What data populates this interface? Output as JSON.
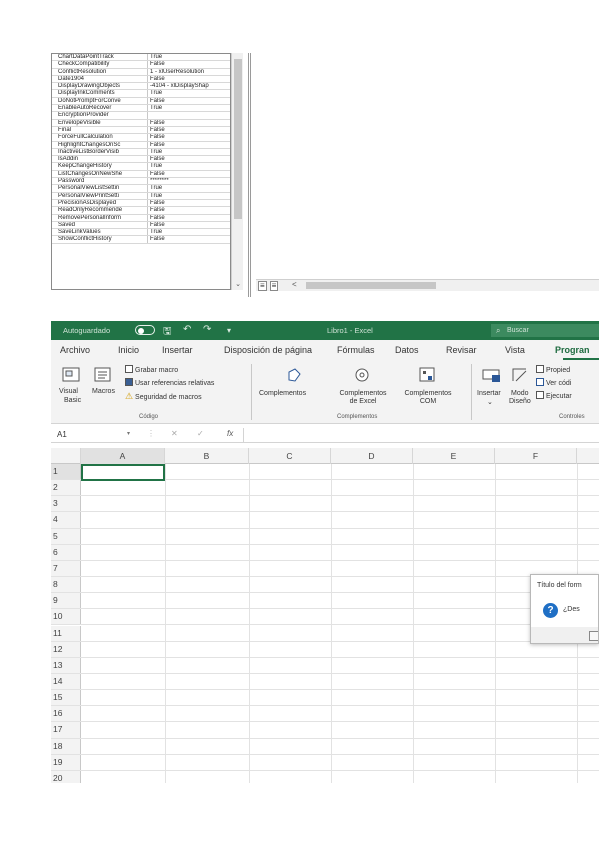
{
  "properties_panel": {
    "rows": [
      {
        "name": "ChartDataPointTrack",
        "value": "True"
      },
      {
        "name": "CheckCompatibility",
        "value": "False"
      },
      {
        "name": "ConflictResolution",
        "value": "1 - xlUserResolution"
      },
      {
        "name": "Date1904",
        "value": "False"
      },
      {
        "name": "DisplayDrawingObjects",
        "value": "-4104 - xlDisplayShap"
      },
      {
        "name": "DisplayInkComments",
        "value": "True"
      },
      {
        "name": "DoNotPromptForConve",
        "value": "False"
      },
      {
        "name": "EnableAutoRecover",
        "value": "True"
      },
      {
        "name": "EncryptionProvider",
        "value": ""
      },
      {
        "name": "EnvelopeVisible",
        "value": "False"
      },
      {
        "name": "Final",
        "value": "False"
      },
      {
        "name": "ForceFullCalculation",
        "value": "False"
      },
      {
        "name": "HighlightChangesOnSc",
        "value": "False"
      },
      {
        "name": "InactiveListBorderVisib",
        "value": "True"
      },
      {
        "name": "IsAddin",
        "value": "False"
      },
      {
        "name": "KeepChangeHistory",
        "value": "True"
      },
      {
        "name": "ListChangesOnNewShe",
        "value": "False"
      },
      {
        "name": "Password",
        "value": "********"
      },
      {
        "name": "PersonalViewListSettin",
        "value": "True"
      },
      {
        "name": "PersonalViewPrintSetti",
        "value": "True"
      },
      {
        "name": "PrecisionAsDisplayed",
        "value": "False"
      },
      {
        "name": "ReadOnlyRecommende",
        "value": "False"
      },
      {
        "name": "RemovePersonalInform",
        "value": "False"
      },
      {
        "name": "Saved",
        "value": "False"
      },
      {
        "name": "SaveLinkValues",
        "value": "True"
      },
      {
        "name": "ShowConflictHistory",
        "value": "False"
      }
    ],
    "scroll_down_arrow": "⌄",
    "hscroll_left_arrow": "<"
  },
  "excel": {
    "titlebar": {
      "autosave_label": "Autoguardado",
      "save_icon": "save-icon",
      "undo_icon": "undo-icon",
      "redo_icon": "redo-icon",
      "title": "Libro1 - Excel",
      "search_placeholder": "Buscar"
    },
    "tabs": [
      {
        "label": "Archivo"
      },
      {
        "label": "Inicio"
      },
      {
        "label": "Insertar"
      },
      {
        "label": "Disposición de página"
      },
      {
        "label": "Fórmulas"
      },
      {
        "label": "Datos"
      },
      {
        "label": "Revisar"
      },
      {
        "label": "Vista"
      },
      {
        "label": "Progran"
      }
    ],
    "ribbon": {
      "visual_basic": "Visual",
      "visual_basic_2": "Basic",
      "macros": "Macros",
      "grabar_macro": "Grabar macro",
      "usar_referencias": "Usar referencias relativas",
      "seguridad_macros": "Seguridad de macros",
      "group_codigo": "Código",
      "complementos": "Complementos",
      "complementos_excel_1": "Complementos",
      "complementos_excel_2": "de Excel",
      "complementos_com_1": "Complementos",
      "complementos_com_2": "COM",
      "group_complementos": "Complementos",
      "insertar": "Insertar",
      "modo_diseno_1": "Modo",
      "modo_diseno_2": "Diseño",
      "propiedades": "Propied",
      "ver_codigo": "Ver códi",
      "ejecutar": "Ejecutar",
      "group_controles": "Controles"
    },
    "formula_bar": {
      "name_box": "A1",
      "cancel": "✕",
      "enter": "✓",
      "fx": "fx"
    },
    "columns": [
      "A",
      "B",
      "C",
      "D",
      "E",
      "F"
    ],
    "rows": [
      "1",
      "2",
      "3",
      "4",
      "5",
      "6",
      "7",
      "8",
      "9",
      "10",
      "11",
      "12",
      "13",
      "14",
      "15",
      "16",
      "17",
      "18",
      "19",
      "20"
    ],
    "dialog": {
      "title": "Título del form",
      "icon": "question-icon",
      "icon_glyph": "?",
      "message": "¿Des"
    },
    "colors": {
      "titlebar": "#217346",
      "accent": "#217346",
      "dialog_icon": "#1f6fc5"
    }
  }
}
